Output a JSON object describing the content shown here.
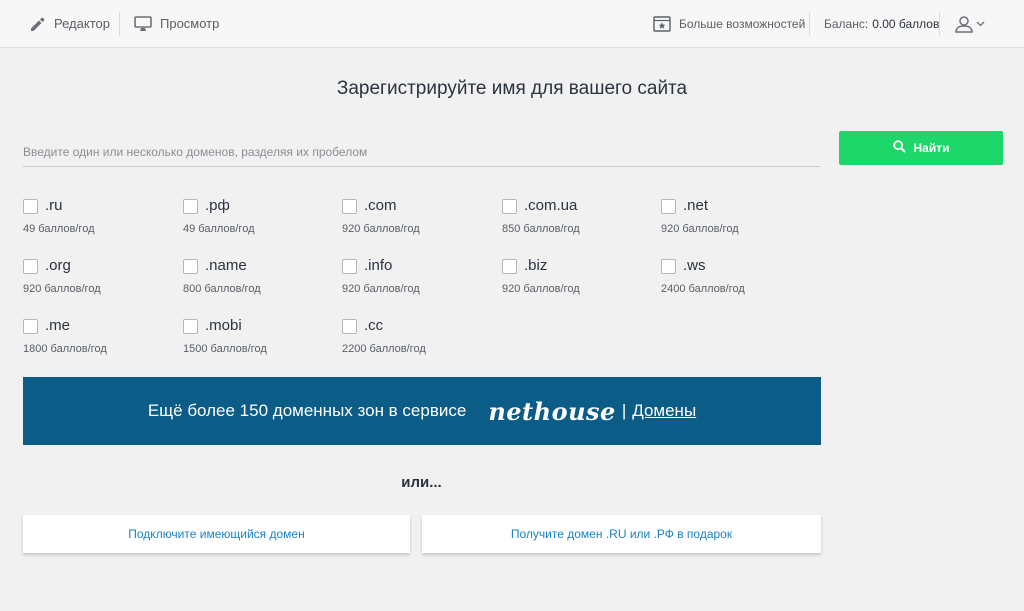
{
  "topbar": {
    "editor_label": "Редактор",
    "preview_label": "Просмотр",
    "more_label": "Больше возможностей",
    "balance_label": "Баланс:",
    "balance_value": "0.00 баллов"
  },
  "main": {
    "title": "Зарегистрируйте имя для вашего сайта",
    "search_placeholder": "Введите один или несколько доменов, разделяя их пробелом",
    "search_value": "",
    "find_label": "Найти",
    "domains": [
      {
        "zone": ".ru",
        "price": "49 баллов/год"
      },
      {
        "zone": ".рф",
        "price": "49 баллов/год"
      },
      {
        "zone": ".com",
        "price": "920 баллов/год"
      },
      {
        "zone": ".com.ua",
        "price": "850 баллов/год"
      },
      {
        "zone": ".net",
        "price": "920 баллов/год"
      },
      {
        "zone": ".org",
        "price": "920 баллов/год"
      },
      {
        "zone": ".name",
        "price": "800 баллов/год"
      },
      {
        "zone": ".info",
        "price": "920 баллов/год"
      },
      {
        "zone": ".biz",
        "price": "920 баллов/год"
      },
      {
        "zone": ".ws",
        "price": "2400 баллов/год"
      },
      {
        "zone": ".me",
        "price": "1800 баллов/год"
      },
      {
        "zone": ".mobi",
        "price": "1500 баллов/год"
      },
      {
        "zone": ".cc",
        "price": "2200 баллов/год"
      }
    ],
    "banner": {
      "text": "Ещё более 150 доменных зон в сервисе",
      "logo": "nethouse",
      "pipe": "|",
      "link": "Домены"
    },
    "or_label": "или...",
    "connect_label": "Подключите имеющийся домен",
    "gift_label": "Получите домен .RU или .РФ в подарок"
  },
  "colors": {
    "accent_green": "#1ed76a",
    "banner_blue": "#0b5c86",
    "link_blue": "#1a82c4"
  }
}
